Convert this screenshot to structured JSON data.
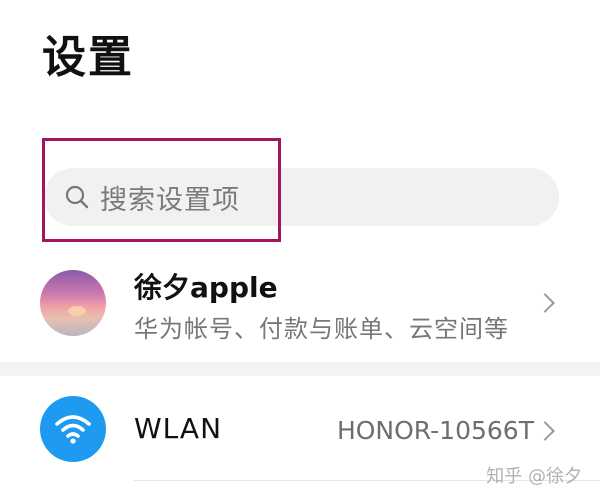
{
  "header": {
    "title": "设置"
  },
  "search": {
    "placeholder": "搜索设置项",
    "icon": "search-icon"
  },
  "account": {
    "name": "徐夕apple",
    "subtitle": "华为帐号、付款与账单、云空间等",
    "avatar": "sunset-avatar",
    "chevron": "chevron-right-icon"
  },
  "wlan": {
    "label": "WLAN",
    "value": "HONOR-10566T",
    "icon": "wifi-icon",
    "icon_color": "#1e9bf0",
    "chevron": "chevron-right-icon"
  },
  "watermark": {
    "text": "知乎 @徐夕"
  },
  "colors": {
    "highlight_border": "#a3165f",
    "search_background": "#f1f1f1"
  }
}
